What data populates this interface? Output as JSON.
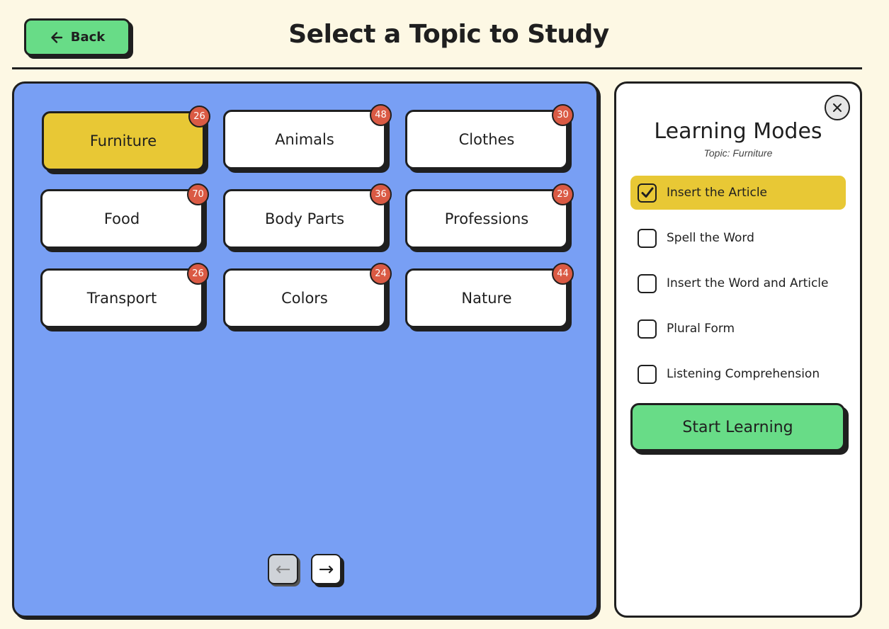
{
  "header": {
    "back_label": "Back",
    "title": "Select a Topic to Study"
  },
  "topics": [
    {
      "label": "Furniture",
      "count": "26",
      "selected": true
    },
    {
      "label": "Animals",
      "count": "48",
      "selected": false
    },
    {
      "label": "Clothes",
      "count": "30",
      "selected": false
    },
    {
      "label": "Food",
      "count": "70",
      "selected": false
    },
    {
      "label": "Body Parts",
      "count": "36",
      "selected": false
    },
    {
      "label": "Professions",
      "count": "29",
      "selected": false
    },
    {
      "label": "Transport",
      "count": "26",
      "selected": false
    },
    {
      "label": "Colors",
      "count": "24",
      "selected": false
    },
    {
      "label": "Nature",
      "count": "44",
      "selected": false
    }
  ],
  "pagination": {
    "prev_label": "←",
    "next_label": "→"
  },
  "modes_panel": {
    "title": "Learning Modes",
    "topic_line": "Topic: Furniture",
    "modes": [
      {
        "label": "Insert the Article",
        "checked": true
      },
      {
        "label": "Spell the Word",
        "checked": false
      },
      {
        "label": "Insert the Word and Article",
        "checked": false
      },
      {
        "label": "Plural Form",
        "checked": false
      },
      {
        "label": "Listening Comprehension",
        "checked": false
      }
    ],
    "start_label": "Start Learning"
  },
  "colors": {
    "background": "#fdf8e4",
    "panel_blue": "#789ff4",
    "selected_yellow": "#e8c835",
    "action_green": "#68dc87",
    "badge_red": "#da5a44"
  },
  "icons": [
    "arrow-left-icon",
    "close-icon",
    "check-icon"
  ]
}
